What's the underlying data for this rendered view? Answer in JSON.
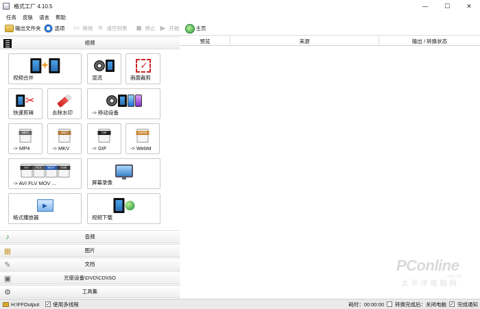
{
  "window": {
    "title": "格式工厂 4.10.5",
    "buttons": {
      "minimize": "—",
      "maximize": "☐",
      "close": "✕"
    }
  },
  "menu": [
    "任务",
    "皮肤",
    "语言",
    "帮助"
  ],
  "toolbar": {
    "output_folder": "输出文件夹",
    "options": "选项",
    "remove": "移除",
    "clear_list": "清空列表",
    "stop": "停止",
    "start": "开始",
    "home": "主页"
  },
  "categories": {
    "video": "视频",
    "audio": "音频",
    "image": "图片",
    "document": "文档",
    "rom": "光驱设备\\DVD\\CD\\ISO",
    "tools": "工具集"
  },
  "tiles": {
    "merge": "视频合并",
    "mux": "混流",
    "crop": "画面裁剪",
    "quick_clip": "快速剪辑",
    "remove_watermark": "去除水印",
    "mobile": "-> 移动设备",
    "mp4": "-> MP4",
    "mkv": "-> MKV",
    "gif": "-> GIF",
    "webm": "-> WebM",
    "avi_flv": "-> AVI FLV MOV ...",
    "screen_record": "屏幕录像",
    "player": "格式播放器",
    "download": "视频下载",
    "tag_mp4": "MP4",
    "tag_mkv": "MKV",
    "tag_gif": "GIF",
    "tag_webm": "WebM",
    "tag_avi": "AVI",
    "tag_flv": "FLV",
    "tag_mov": "MOV",
    "tag_vob": "VOB"
  },
  "table": {
    "columns": [
      "预览",
      "来源",
      "输出 / 转换状态"
    ]
  },
  "watermark": {
    "logo": "PConline",
    "sub": "太平洋电脑网",
    "url": ".com.cn"
  },
  "status": {
    "output_path": "H:\\FFOutput",
    "multithread": "使用多线程",
    "elapsed": "耗时：00:00:00",
    "after_convert": "转换完成后：关闭电脑",
    "notify": "完成通知"
  }
}
